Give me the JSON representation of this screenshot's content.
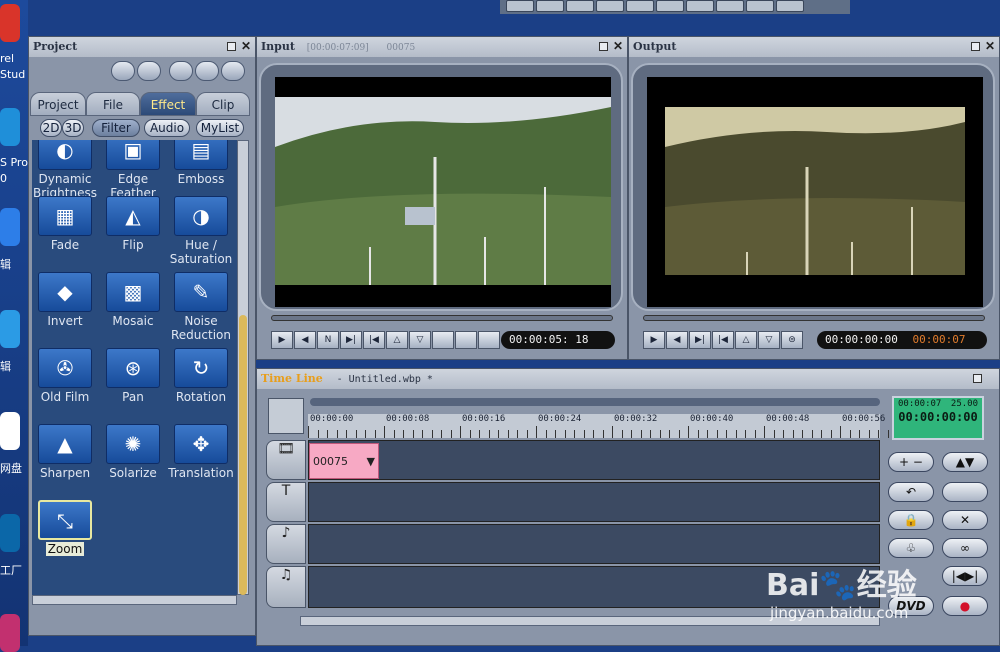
{
  "desktop": {
    "labels": [
      "rel",
      "Stud",
      "S Pro",
      "0",
      "辑",
      "辑",
      "网盘",
      "工厂"
    ]
  },
  "project": {
    "title": "Project",
    "tabs": [
      "Project",
      "File",
      "Effect",
      "Clip"
    ],
    "active_tab": "Effect",
    "filters": [
      "2D",
      "3D",
      "Filter",
      "Audio",
      "MyList"
    ],
    "active_filter": "Filter",
    "effects": [
      {
        "label": "Dynamic\nBrightness",
        "icon": "brightness-icon",
        "glyph": "◐"
      },
      {
        "label": "Edge\nFeather",
        "icon": "edge-feather-icon",
        "glyph": "▣"
      },
      {
        "label": "Emboss",
        "icon": "emboss-icon",
        "glyph": "▤"
      },
      {
        "label": "Fade",
        "icon": "fade-icon",
        "glyph": "▦"
      },
      {
        "label": "Flip",
        "icon": "flip-icon",
        "glyph": "◭"
      },
      {
        "label": "Hue /\nSaturation",
        "icon": "hue-saturation-icon",
        "glyph": "◑"
      },
      {
        "label": "Invert",
        "icon": "invert-icon",
        "glyph": "◆"
      },
      {
        "label": "Mosaic",
        "icon": "mosaic-icon",
        "glyph": "▩"
      },
      {
        "label": "Noise\nReduction",
        "icon": "noise-reduction-icon",
        "glyph": "✎"
      },
      {
        "label": "Old Film",
        "icon": "old-film-icon",
        "glyph": "✇"
      },
      {
        "label": "Pan",
        "icon": "pan-icon",
        "glyph": "⊛"
      },
      {
        "label": "Rotation",
        "icon": "rotation-icon",
        "glyph": "↻"
      },
      {
        "label": "Sharpen",
        "icon": "sharpen-icon",
        "glyph": "▲"
      },
      {
        "label": "Solarize",
        "icon": "solarize-icon",
        "glyph": "✺"
      },
      {
        "label": "Translation",
        "icon": "translation-icon",
        "glyph": "✥"
      },
      {
        "label": "Zoom",
        "icon": "zoom-icon",
        "glyph": "⤡"
      }
    ]
  },
  "input": {
    "title": "Input",
    "timecode_header": "[00:00:07:09]",
    "clip_id": "00075",
    "timecode": "00:00:05: 18"
  },
  "output": {
    "title": "Output",
    "timecode": "00:00:00:00",
    "timecode2": "00:00:07"
  },
  "timeline": {
    "title": "Time Line",
    "file": "- Untitled.wbp *",
    "ticks": [
      "00:00:00",
      "00:00:08",
      "00:00:16",
      "00:00:24",
      "00:00:32",
      "00:00:40",
      "00:00:48",
      "00:00:56"
    ],
    "clip_label": "00075",
    "counter_top": "00:00:07",
    "counter_fps": "25.00",
    "counter_main": "00:00:00:00",
    "dvd": "DVD"
  },
  "watermark": {
    "brand": "Bai",
    "brand2": "经验",
    "url": "jingyan.baidu.com"
  }
}
